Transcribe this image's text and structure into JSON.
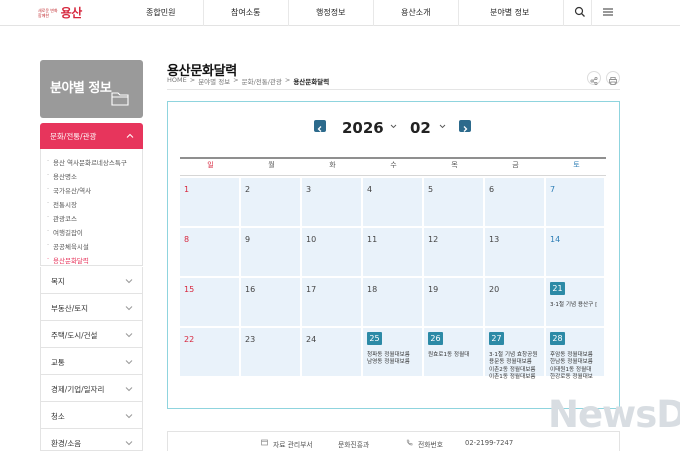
{
  "header": {
    "logo_small_1": "새로운 변화",
    "logo_small_2": "함께한",
    "logo_main": "용산",
    "nav": [
      "종합민원",
      "참여소통",
      "행정정보",
      "용산소개",
      "분야별 정보"
    ]
  },
  "sidebar": {
    "banner_title": "분야별 정보",
    "active_section": "문화/전통/관광",
    "sub_items": [
      "용산 역사문화르네상스특구",
      "용산명소",
      "국가유산/역사",
      "전통시장",
      "관광코스",
      "여행길잡이",
      "공공체육시설",
      "용산문화달력"
    ],
    "active_sub_index": 7,
    "menus": [
      "복지",
      "부동산/토지",
      "주택/도시/건설",
      "교통",
      "경제/기업/일자리",
      "청소",
      "환경/소음"
    ]
  },
  "page": {
    "title": "용산문화달력",
    "breadcrumb": [
      "HOME",
      ">",
      "분야별 정보",
      ">",
      "문화/전통/관광",
      ">",
      "용산문화달력"
    ]
  },
  "calendar": {
    "year": "2026",
    "month": "02",
    "weekdays": [
      "일",
      "월",
      "화",
      "수",
      "목",
      "금",
      "토"
    ],
    "weeks": [
      [
        {
          "d": "1"
        },
        {
          "d": "2"
        },
        {
          "d": "3"
        },
        {
          "d": "4"
        },
        {
          "d": "5"
        },
        {
          "d": "6"
        },
        {
          "d": "7"
        }
      ],
      [
        {
          "d": "8"
        },
        {
          "d": "9"
        },
        {
          "d": "10"
        },
        {
          "d": "11"
        },
        {
          "d": "12"
        },
        {
          "d": "13"
        },
        {
          "d": "14"
        }
      ],
      [
        {
          "d": "15"
        },
        {
          "d": "16"
        },
        {
          "d": "17"
        },
        {
          "d": "18"
        },
        {
          "d": "19"
        },
        {
          "d": "20"
        },
        {
          "d": "21",
          "events": [
            "3·1절 기념 용산구 ["
          ]
        }
      ],
      [
        {
          "d": "22"
        },
        {
          "d": "23"
        },
        {
          "d": "24"
        },
        {
          "d": "25",
          "events": [
            "청파동 정월대보름",
            "남영동 정월대보름"
          ]
        },
        {
          "d": "26",
          "events": [
            "원효로1동 정월대"
          ]
        },
        {
          "d": "27",
          "events": [
            "3·1절 기념 효창공원",
            "용문동 정월대보름",
            "이촌2동 정월대보름",
            "이촌1동 정월대보름"
          ]
        },
        {
          "d": "28",
          "events": [
            "후암동 정월대보름",
            "한남동 정월대보름",
            "이태원1동 정월대",
            "한강로동 정월대보"
          ]
        }
      ]
    ]
  },
  "footer": {
    "dept_label": "자료 관리부서",
    "dept_value": "문화진흥과",
    "phone_label": "전화번호",
    "phone_value": "02-2199-7247"
  },
  "watermark": "NewsDa",
  "colors": {
    "accent": "#e7355c",
    "calendar_cell": "#e9f2fa",
    "event_badge": "#2c8aa6",
    "calendar_border": "#8fd4de"
  }
}
